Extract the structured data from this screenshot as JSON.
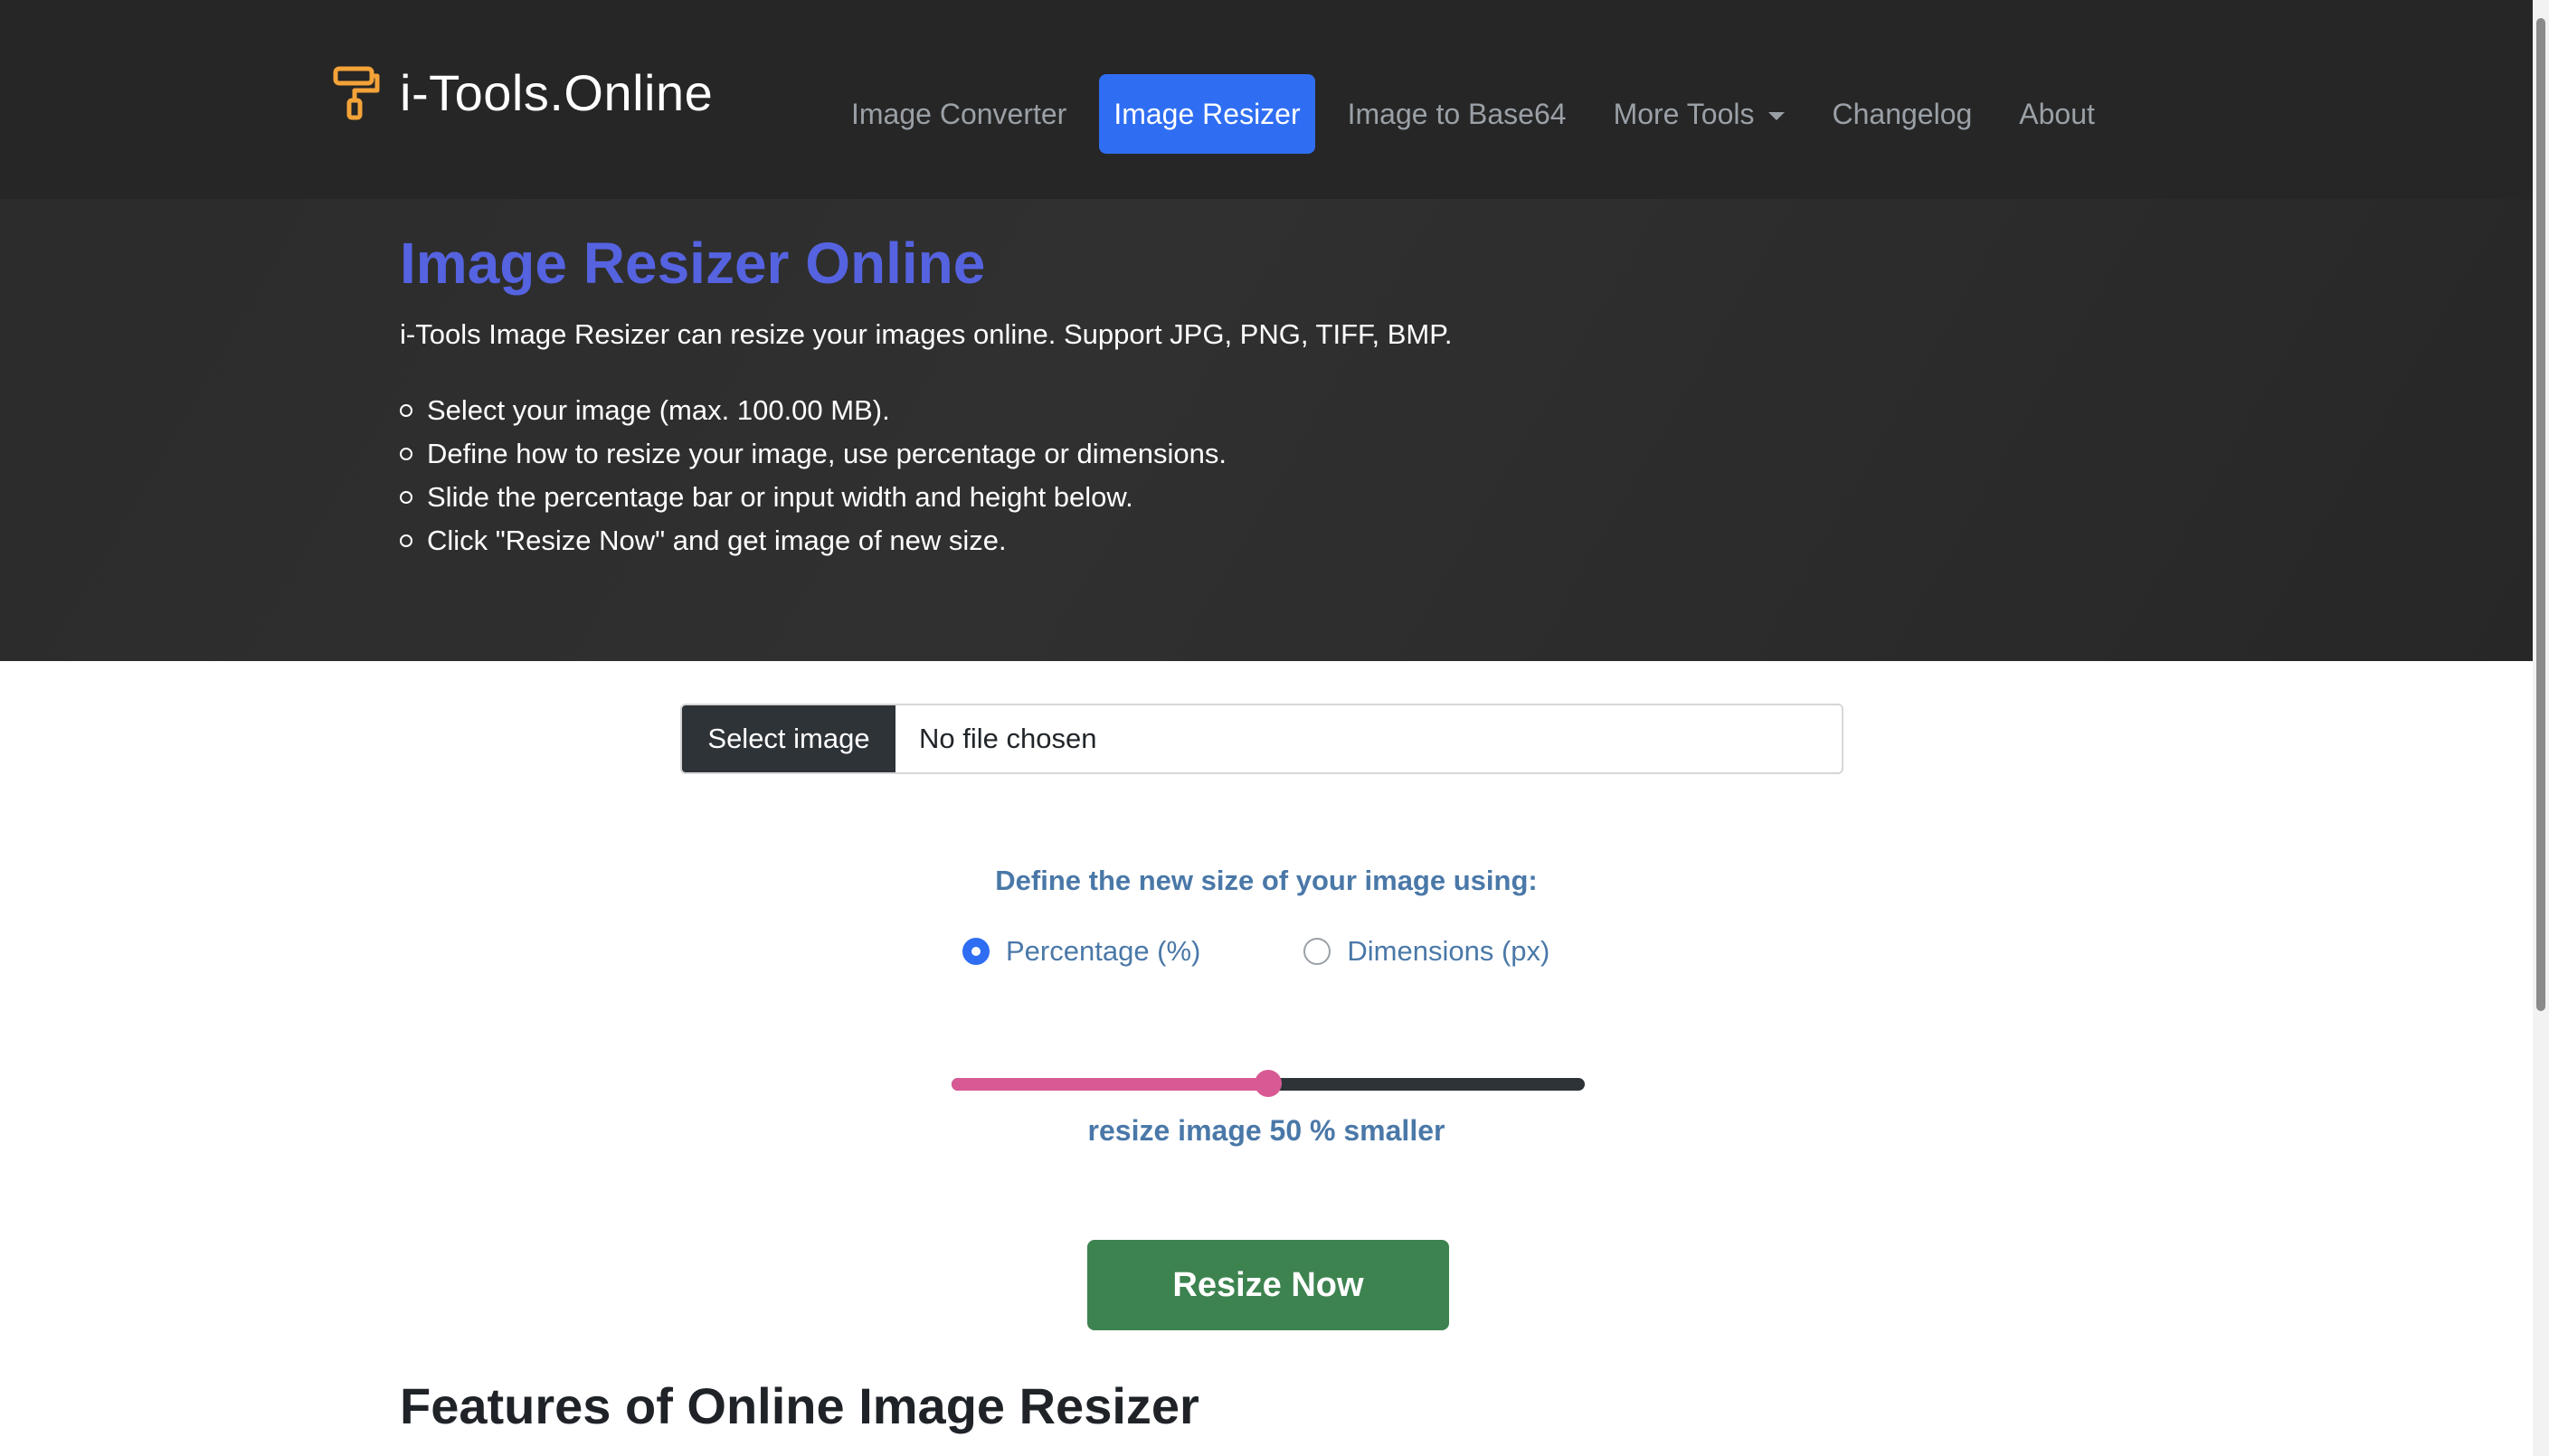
{
  "brand": {
    "name": "i-Tools.Online",
    "icon": "paint-roller-icon",
    "color": "#f4a338"
  },
  "nav": {
    "items": [
      {
        "label": "Image Converter"
      },
      {
        "label": "Image Resizer",
        "active": true
      },
      {
        "label": "Image to Base64"
      },
      {
        "label": "More Tools",
        "dropdown": true
      },
      {
        "label": "Changelog"
      },
      {
        "label": "About"
      }
    ],
    "active_color": "#2f6ef2"
  },
  "hero": {
    "title": "Image Resizer Online",
    "description": "i-Tools Image Resizer can resize your images online. Support JPG, PNG, TIFF, BMP.",
    "steps": [
      "Select your image (max. 100.00 MB).",
      "Define how to resize your image, use percentage or dimensions.",
      "Slide the percentage bar or input width and height below.",
      "Click \"Resize Now\" and get image of new size."
    ],
    "title_color": "#5563e0"
  },
  "file_input": {
    "button_label": "Select image",
    "status": "No file chosen"
  },
  "size_options": {
    "label": "Define the new size of your image using:",
    "options": [
      {
        "label": "Percentage (%)",
        "checked": true
      },
      {
        "label": "Dimensions (px)",
        "checked": false
      }
    ]
  },
  "slider": {
    "value": 50,
    "min": 0,
    "max": 100,
    "text_prefix": "resize image",
    "text_value": "50",
    "text_suffix": "% smaller",
    "fill_color": "#d85a95"
  },
  "resize_button": {
    "label": "Resize Now",
    "color": "#3d8350"
  },
  "features": {
    "title": "Features of Online Image Resizer"
  }
}
